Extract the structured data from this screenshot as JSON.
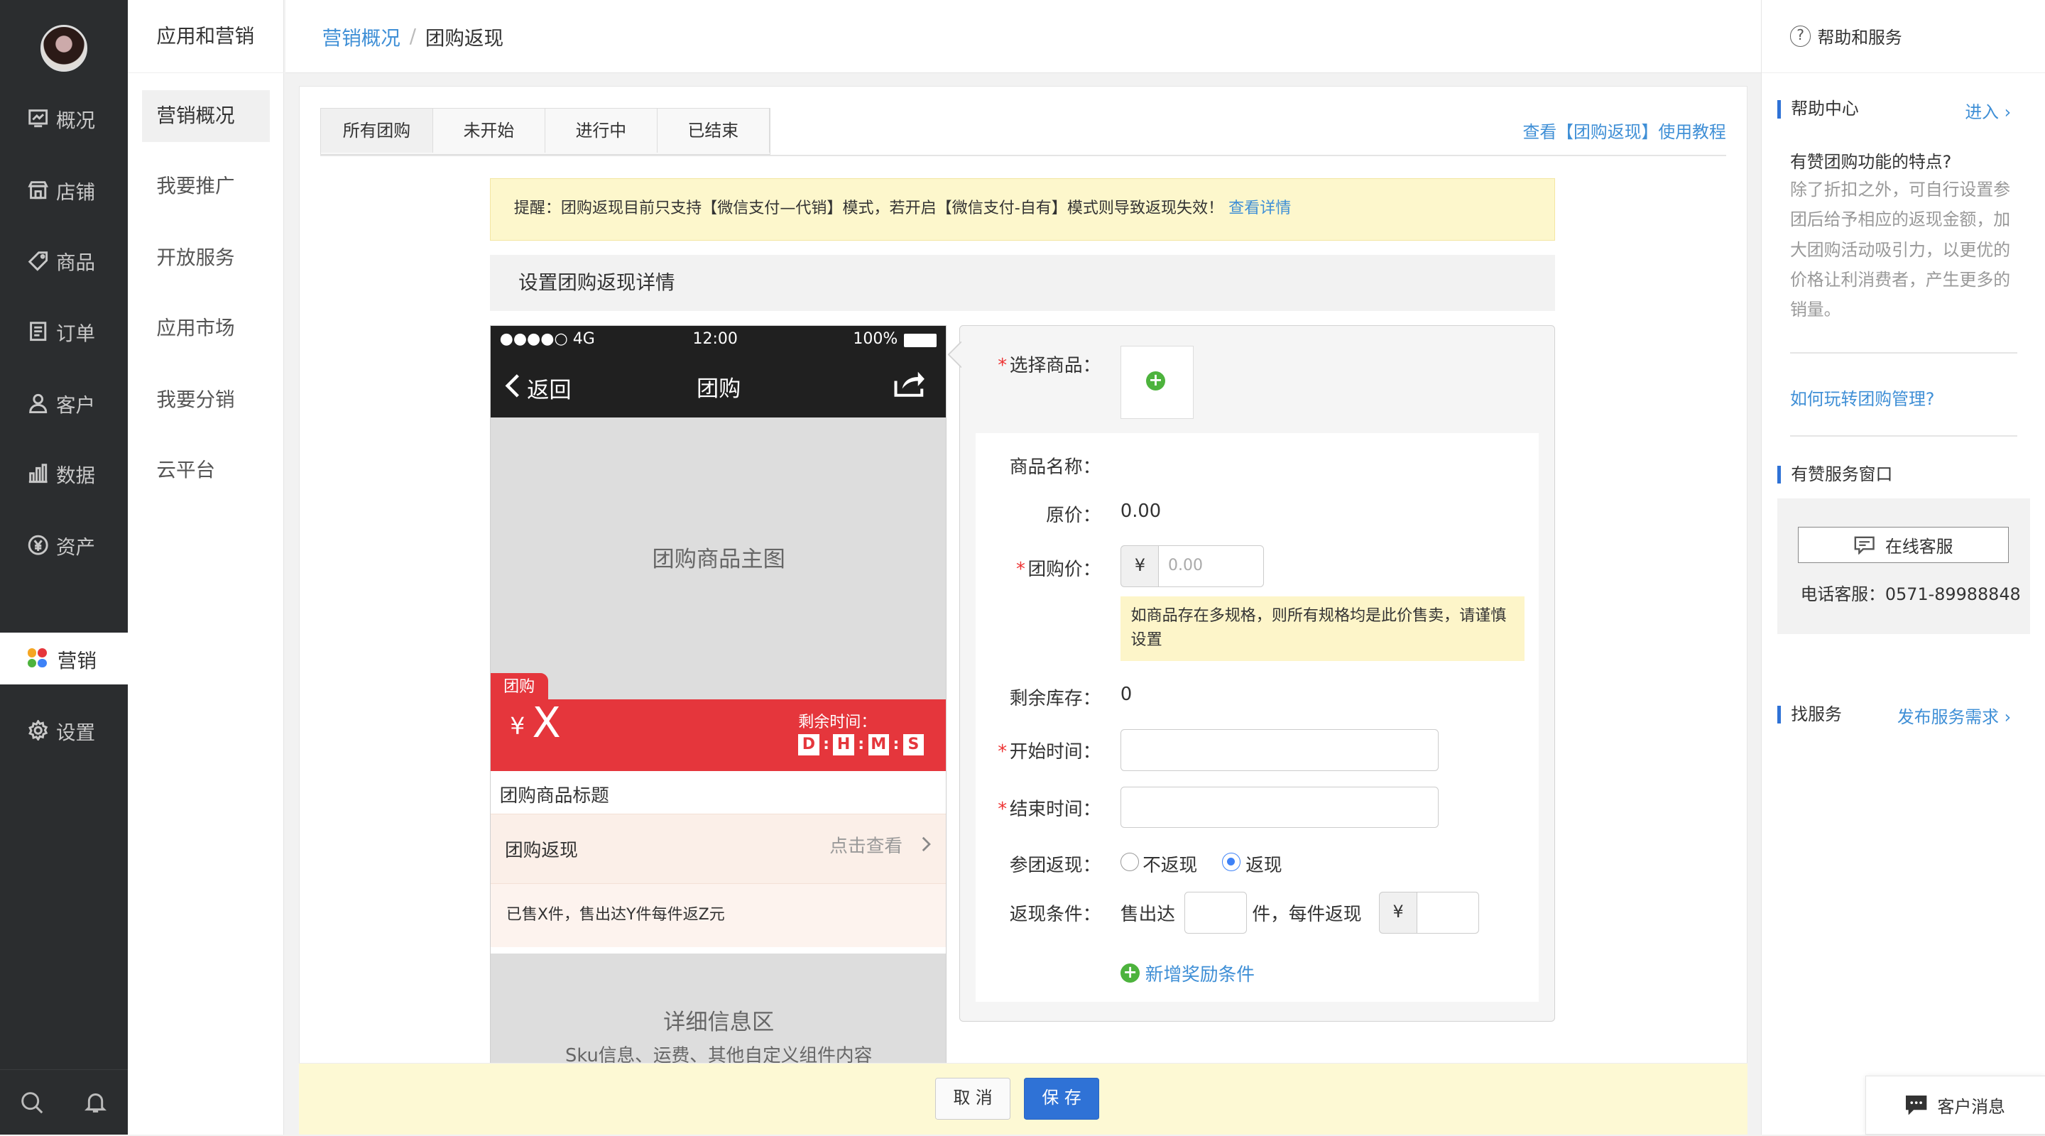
{
  "nav": {
    "items": [
      {
        "label": "概况",
        "icon": "overview-icon"
      },
      {
        "label": "店铺",
        "icon": "store-icon"
      },
      {
        "label": "商品",
        "icon": "tag-icon"
      },
      {
        "label": "订单",
        "icon": "order-icon"
      },
      {
        "label": "客户",
        "icon": "user-icon"
      },
      {
        "label": "数据",
        "icon": "bar-chart-icon"
      },
      {
        "label": "资产",
        "icon": "yuan-icon"
      },
      {
        "label": "营销",
        "icon": "flower-icon"
      },
      {
        "label": "设置",
        "icon": "gear-icon"
      }
    ],
    "active": "营销"
  },
  "subnav": {
    "title": "应用和营销",
    "items": [
      "营销概况",
      "我要推广",
      "开放服务",
      "应用市场",
      "我要分销",
      "云平台"
    ]
  },
  "breadcrumb": {
    "parent": "营销概况",
    "sep": "/",
    "current": "团购返现"
  },
  "tabs": [
    "所有团购",
    "未开始",
    "进行中",
    "已结束"
  ],
  "tutorial_link": "查看【团购返现】使用教程",
  "reminder": {
    "text": "提醒：团购返现目前只支持【微信支付—代销】模式，若开启【微信支付-自有】模式则导致返现失效！",
    "link": "查看详情"
  },
  "section_title": "设置团购返现详情",
  "phone": {
    "signal": "●●●●○ 4G",
    "time": "12:00",
    "battery": "100%",
    "back": "返回",
    "title": "团购",
    "main_image": "团购商品主图",
    "tag": "团购",
    "currency": "¥",
    "price": "X",
    "countdown_label": "剩余时间：",
    "countdown": [
      "D",
      "H",
      "M",
      "S"
    ],
    "product_title": "团购商品标题",
    "rebate_label": "团购返现",
    "rebate_view": "点击查看",
    "rebate_info": "已售X件，售出达Y件每件返Z元",
    "detail_title": "详细信息区",
    "detail_sub": "Sku信息、运费、其他自定义组件内容"
  },
  "form": {
    "select_product": "选择商品：",
    "product_name": "商品名称：",
    "original_price_label": "原价：",
    "original_price": "0.00",
    "group_price_label": "团购价：",
    "currency": "¥",
    "group_price_placeholder": "0.00",
    "price_tip": "如商品存在多规格，则所有规格均是此价售卖，请谨慎设置",
    "stock_label": "剩余库存：",
    "stock": "0",
    "start_label": "开始时间：",
    "end_label": "结束时间：",
    "join_rebate_label": "参团返现：",
    "no_rebate": "不返现",
    "rebate": "返现",
    "cond_label": "返现条件：",
    "sold_reach": "售出达",
    "per_item": "件，每件返现",
    "add_condition": "新增奖励条件"
  },
  "buttons": {
    "cancel": "取 消",
    "save": "保 存"
  },
  "help": {
    "title": "帮助和服务",
    "center": "帮助中心",
    "enter": "进入",
    "faq_q": "有赞团购功能的特点?",
    "faq_a": "除了折扣之外，可自行设置参团后给予相应的返现金额，加大团购活动吸引力，以更优的价格让利消费者，产生更多的销量。",
    "how_link": "如何玩转团购管理?",
    "service_window": "有赞服务窗口",
    "online_service": "在线客服",
    "phone_line": "电话客服：0571-89988848",
    "find_service": "找服务",
    "publish_need": "发布服务需求"
  },
  "customer_message": "客户消息",
  "colors": {
    "accent": "#3f8fd6",
    "save_button": "#2f72d6",
    "red": "#e5363c",
    "sidebar": "#2b2d2f"
  }
}
